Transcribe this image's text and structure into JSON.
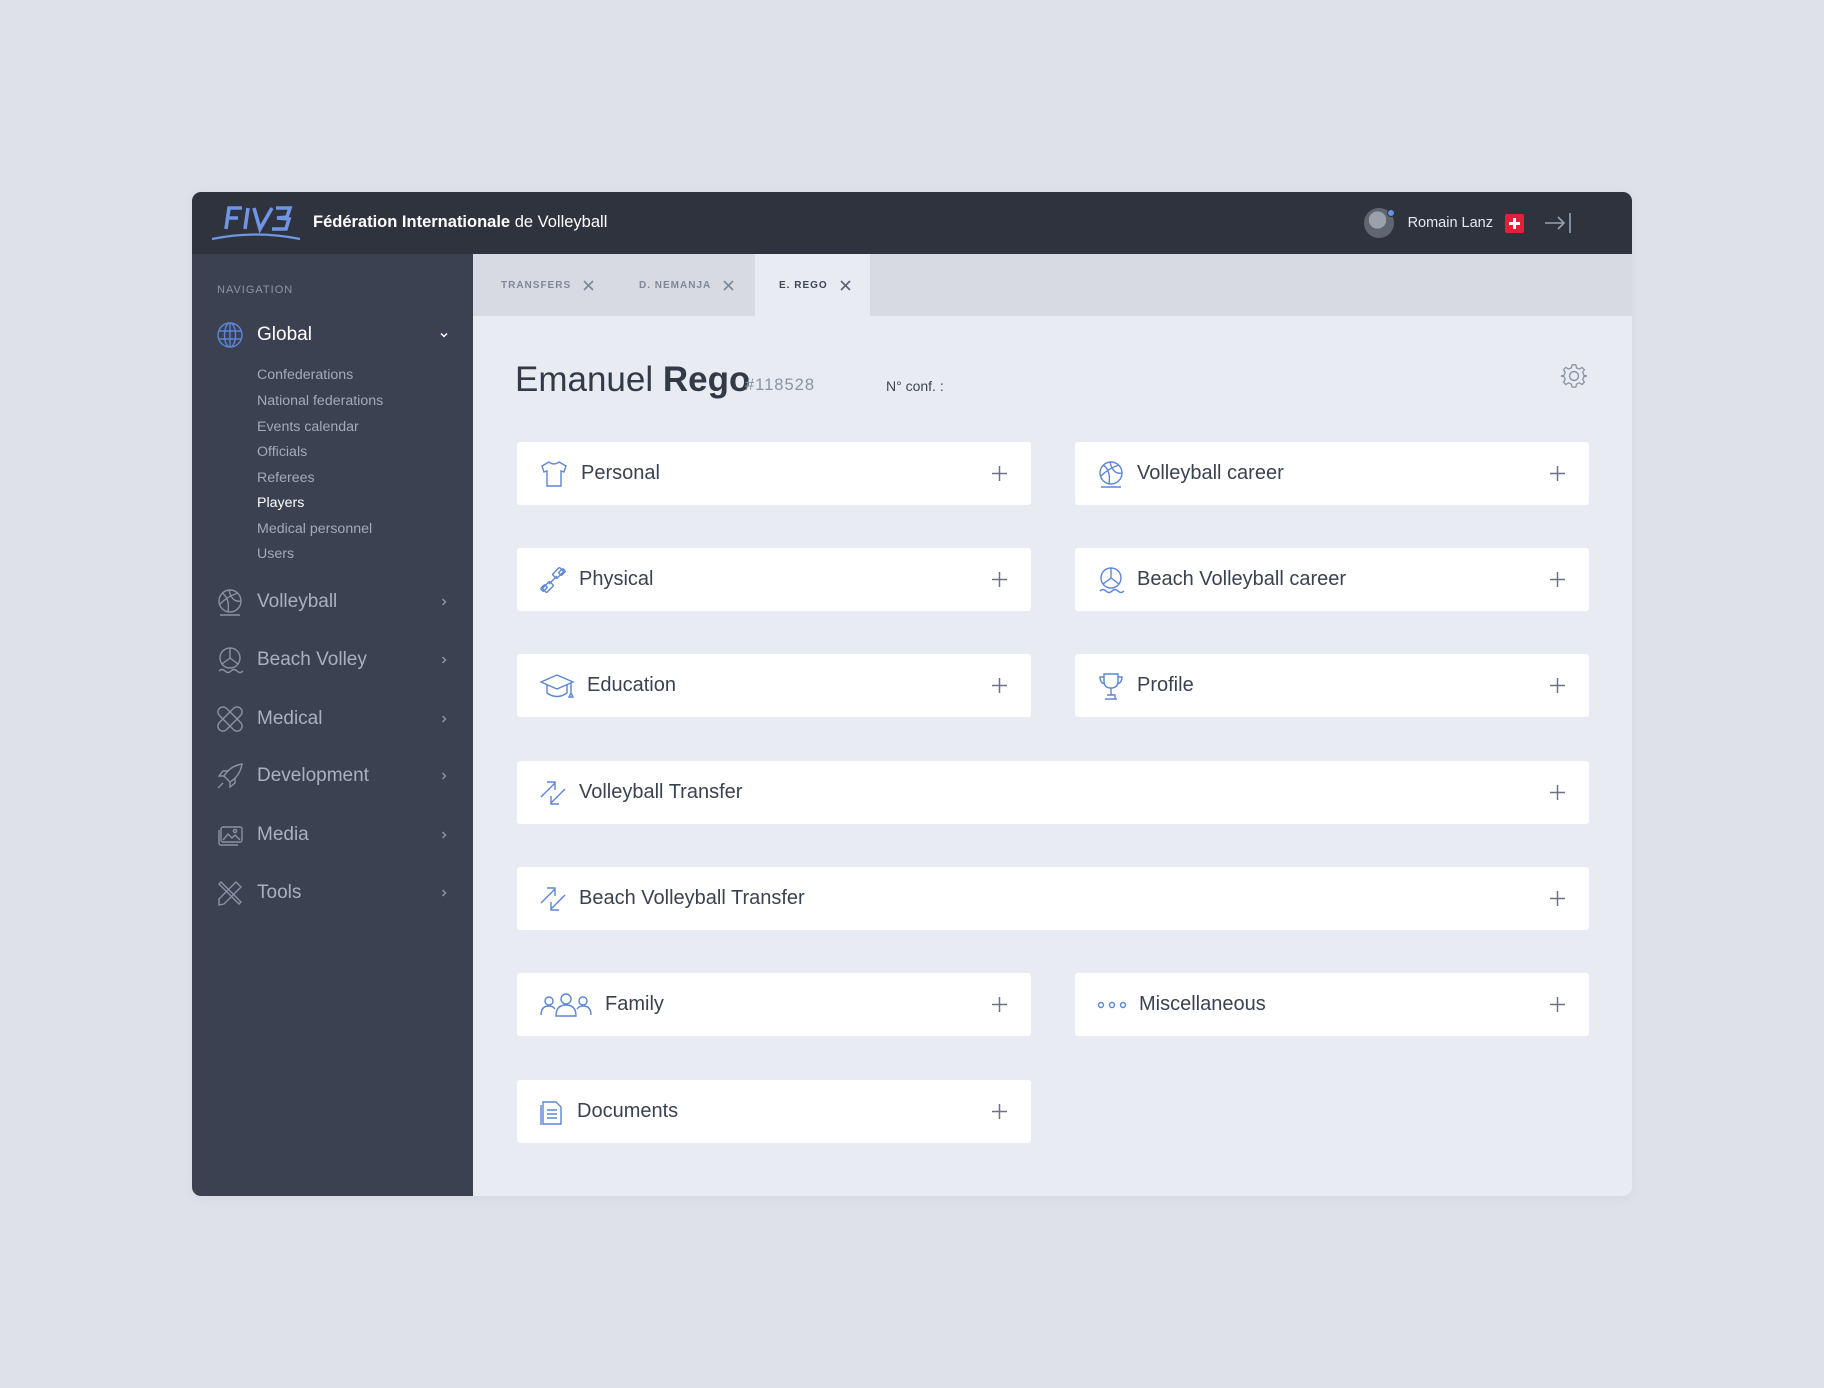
{
  "header": {
    "brand_bold": "Fédération Internationale",
    "brand_rest": " de Volleyball",
    "user_name": "Romain Lanz"
  },
  "sidebar": {
    "heading": "NAVIGATION",
    "global": {
      "label": "Global",
      "icon": "globe-icon",
      "expanded": true
    },
    "global_items": [
      "Confederations",
      "National federations",
      "Events calendar",
      "Officials",
      "Referees",
      "Players",
      "Medical personnel",
      "Users"
    ],
    "current_item": "Players",
    "sections": [
      {
        "label": "Volleyball",
        "icon": "volleyball-icon"
      },
      {
        "label": "Beach Volley",
        "icon": "beach-volleyball-icon"
      },
      {
        "label": "Medical",
        "icon": "bandage-icon"
      },
      {
        "label": "Development",
        "icon": "rocket-icon"
      },
      {
        "label": "Media",
        "icon": "media-icon"
      },
      {
        "label": "Tools",
        "icon": "tools-icon"
      }
    ]
  },
  "tabs": [
    {
      "label": "TRANSFERS",
      "active": false
    },
    {
      "label": "D. NEMANJA",
      "active": false
    },
    {
      "label": "E. REGO",
      "active": true
    }
  ],
  "player": {
    "first_name": "Emanuel ",
    "last_name": "Rego",
    "id": "#118528",
    "conf_label": "N° conf. :"
  },
  "sections": [
    {
      "label": "Personal",
      "icon": "shirt-icon"
    },
    {
      "label": "Volleyball career",
      "icon": "volleyball-icon"
    },
    {
      "label": "Physical",
      "icon": "dumbbell-icon"
    },
    {
      "label": "Beach Volleyball career",
      "icon": "beach-volleyball-icon"
    },
    {
      "label": "Education",
      "icon": "graduation-cap-icon"
    },
    {
      "label": "Profile",
      "icon": "trophy-icon"
    },
    {
      "label": "Volleyball Transfer",
      "icon": "transfer-arrows-icon"
    },
    {
      "label": "Beach Volleyball Transfer",
      "icon": "transfer-arrows-icon"
    },
    {
      "label": "Family",
      "icon": "family-icon"
    },
    {
      "label": "Miscellaneous",
      "icon": "more-dots-icon"
    },
    {
      "label": "Documents",
      "icon": "document-icon"
    }
  ],
  "colors": {
    "topbar": "#2f333e",
    "sidebar": "#3b4150",
    "accent": "#5b86d6",
    "content_bg": "#e8ebf2",
    "flag_red": "#e1203a"
  }
}
